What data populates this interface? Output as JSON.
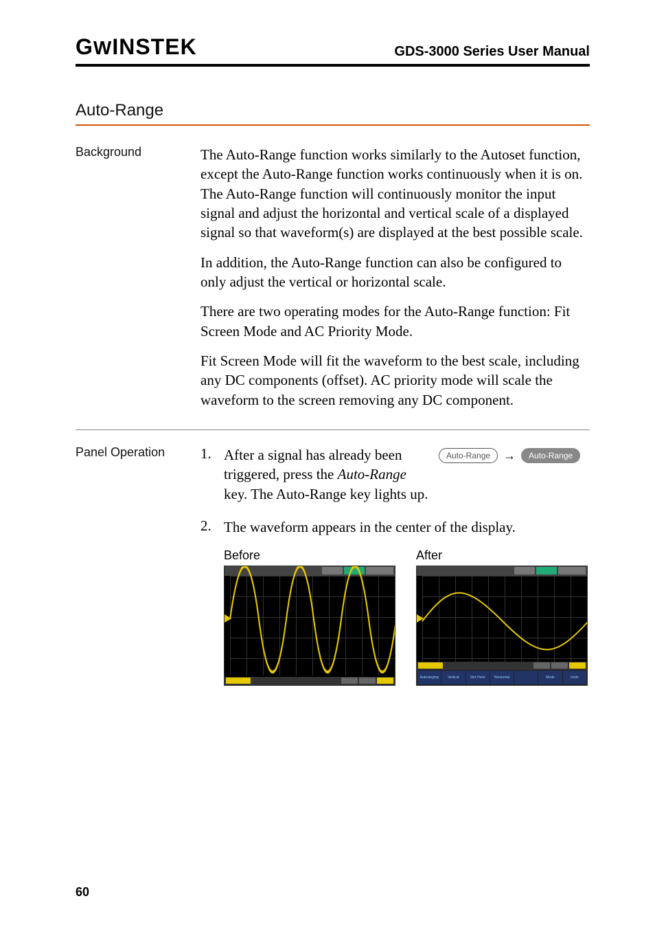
{
  "header": {
    "logo": "GWINSTEK",
    "title": "GDS-3000 Series User Manual"
  },
  "section": {
    "title": "Auto-Range"
  },
  "background": {
    "label": "Background",
    "paras": [
      "The Auto-Range function works similarly to the Autoset function, except the Auto-Range function works continuously when it is on. The Auto-Range function will continuously monitor the input signal and adjust the horizontal and vertical scale of a displayed signal so that waveform(s) are displayed at the best possible scale.",
      "In addition, the Auto-Range function can also be configured to only adjust the vertical or horizontal scale.",
      "There are two operating modes for the Auto-Range function: Fit Screen Mode and AC Priority Mode.",
      "Fit Screen Mode will fit the waveform to the best scale, including any DC components (offset). AC priority mode will scale the waveform to the screen removing any DC component."
    ]
  },
  "panel": {
    "label": "Panel Operation",
    "step1": {
      "num": "1.",
      "text_pre": "After a signal has already been triggered, press the ",
      "key_name": "Auto-Range",
      "text_post": " key. The Auto-Range key lights up."
    },
    "key_badge": "Auto-Range",
    "step2": {
      "num": "2.",
      "text": "The waveform appears in the center of the display."
    },
    "before_label": "Before",
    "after_label": "After"
  },
  "page_number": "60"
}
